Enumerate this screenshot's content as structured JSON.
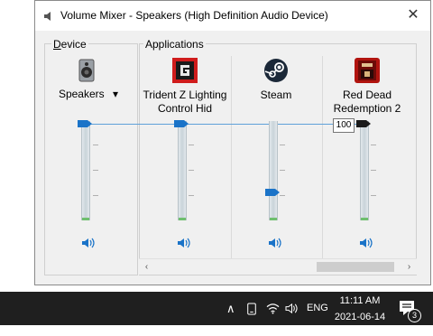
{
  "window": {
    "title": "Volume Mixer - Speakers (High Definition Audio Device)",
    "close_glyph": "✕"
  },
  "device_section": {
    "label_underlined": "D",
    "label_rest": "evice",
    "device_name": "Speakers",
    "dropdown_glyph": "▾",
    "volume": 100
  },
  "applications_section": {
    "label": "Applications",
    "apps": [
      {
        "name_line1": "Trident Z Lighting",
        "name_line2": "Control Hid",
        "icon": "trident-z-icon",
        "volume": 100
      },
      {
        "name_line1": "Steam",
        "name_line2": "",
        "icon": "steam-icon",
        "volume": 28
      },
      {
        "name_line1": "Red Dead",
        "name_line2": "Redemption 2",
        "icon": "red-dead-redemption-2-icon",
        "volume": 100
      }
    ]
  },
  "tooltip_value": "100",
  "scrollbar": {
    "left_glyph": "‹",
    "right_glyph": "›"
  },
  "taskbar": {
    "chevron_glyph": "∧",
    "language": "ENG",
    "time": "11:11 AM",
    "date": "2021-06-14",
    "notification_count": "3"
  },
  "colors": {
    "accent": "#1a73c8",
    "active_thumb": "#1b1b1b",
    "taskbar": "#1f1f1f"
  }
}
